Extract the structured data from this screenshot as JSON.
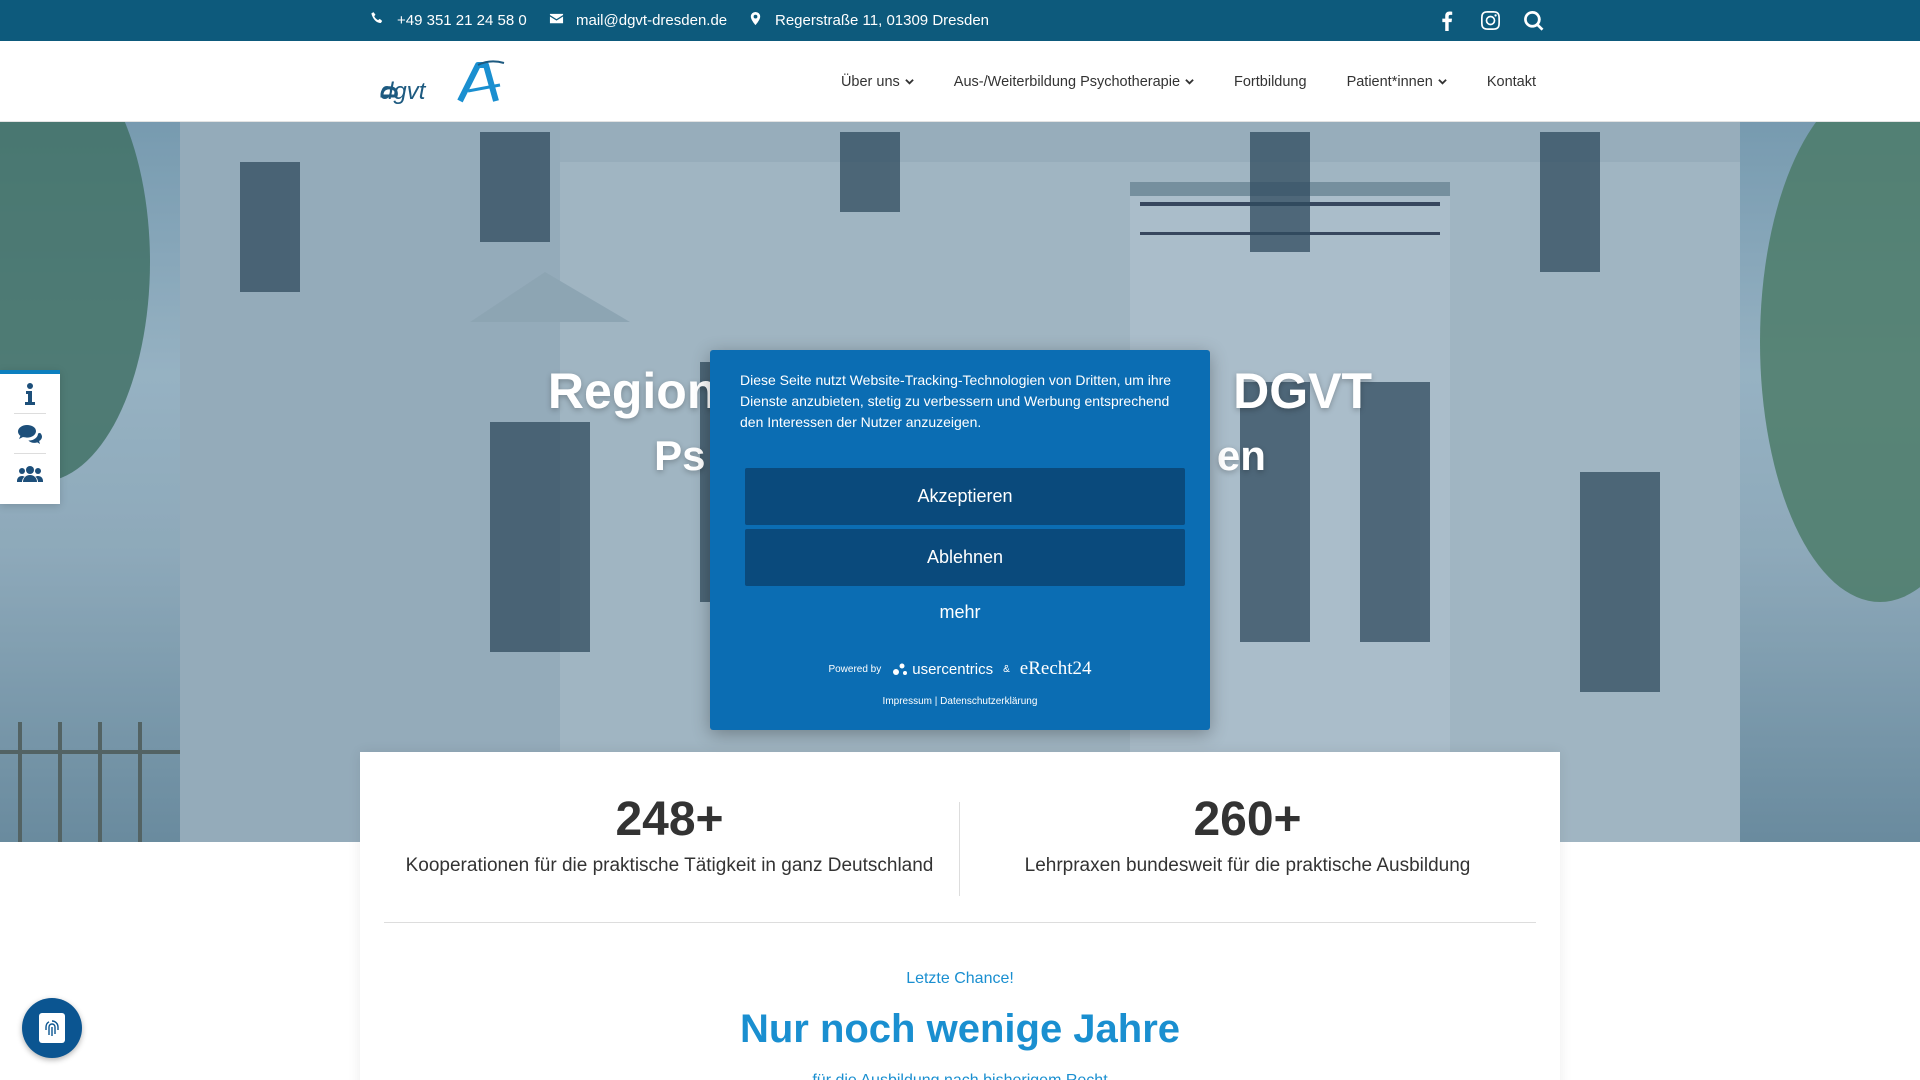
{
  "topbar": {
    "phone": "+49 351 21 24 58 0",
    "email": "mail@dgvt-dresden.de",
    "address": "Regerstraße 11, 01309 Dresden",
    "icons": [
      "phone-icon",
      "envelope-icon",
      "map-pin-icon",
      "facebook-icon",
      "instagram-icon",
      "search-icon"
    ]
  },
  "header": {
    "logo_text": "dgvtA",
    "nav": [
      {
        "label": "Über uns",
        "has_dropdown": true
      },
      {
        "label": "Aus-/Weiterbildung Psychotherapie",
        "has_dropdown": true
      },
      {
        "label": "Fortbildung",
        "has_dropdown": false
      },
      {
        "label": "Patient*innen",
        "has_dropdown": true
      },
      {
        "label": "Kontakt",
        "has_dropdown": false
      }
    ]
  },
  "hero": {
    "title_left": "Region",
    "title_right": "DGVT",
    "subtitle_left": "Ps",
    "subtitle_right": "en"
  },
  "sidewidget": {
    "icons": [
      "info-icon",
      "chat-bubbles-icon",
      "users-icon"
    ]
  },
  "stats": [
    {
      "number": "248+",
      "label": "Kooperationen für die praktische Tätigkeit in ganz Deutschland"
    },
    {
      "number": "260+",
      "label": "Lehrpraxen bundesweit für die praktische Ausbildung"
    }
  ],
  "section": {
    "kicker": "Letzte Chance!",
    "title": "Nur noch wenige Jahre",
    "cut_text": "für die Ausbildung nach bisherigem Recht"
  },
  "cookie": {
    "message": "Diese Seite nutzt Website-Tracking-Technologien von Dritten, um ihre Dienste anzubieten, stetig zu verbessern und Werbung entsprechend den Interessen der Nutzer anzuzeigen.",
    "accept": "Akzeptieren",
    "decline": "Ablehnen",
    "more": "mehr",
    "powered_by": "Powered by",
    "usercentrics": "usercentrics",
    "amp": "&",
    "erecht": "eRecht24",
    "links": "Impressum | Datenschutzerklärung"
  },
  "colors": {
    "topbar": "#0d5a7c",
    "accent": "#1a8fd0",
    "cookie_bg": "#0b6db3",
    "cookie_btn": "#0a4a7c"
  }
}
